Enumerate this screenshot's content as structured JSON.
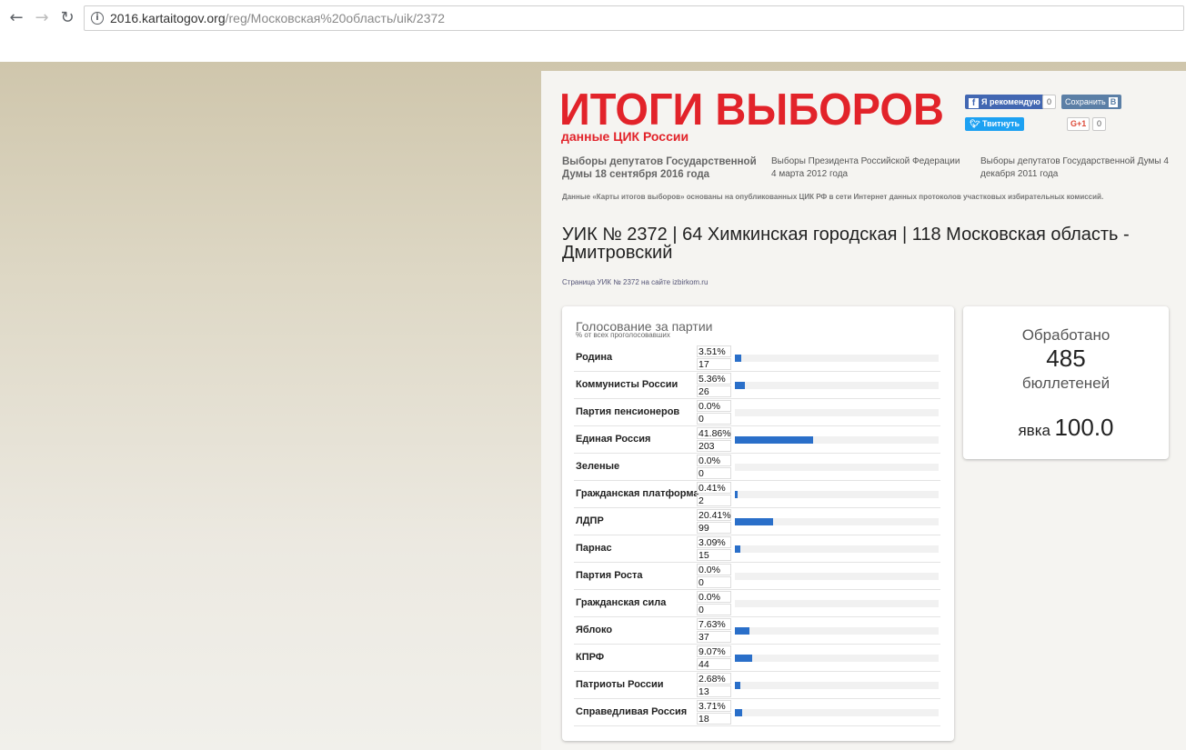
{
  "browser": {
    "url_host": "2016.kartaitogov.org",
    "url_path": "/reg/Московская%20область/uik/2372"
  },
  "header": {
    "logo_title": "ИТОГИ ВЫБОРОВ",
    "logo_subtitle": "данные ЦИК России"
  },
  "social": {
    "fb_label": "Я рекомендую",
    "fb_count": "0",
    "vk_label": "Сохранить",
    "vk_icon": "В",
    "tw_label": "Твитнуть",
    "gp_label": "G+1",
    "gp_count": "0"
  },
  "elections": [
    {
      "label": "Выборы депутатов Государственной Думы 18 сентября 2016 года",
      "active": true
    },
    {
      "label": "Выборы Президента Российской Федерации 4 марта 2012 года",
      "active": false
    },
    {
      "label": "Выборы депутатов Государственной Думы 4 декабря 2011 года",
      "active": false
    }
  ],
  "disclaimer": "Данные «Карты итогов выборов» основаны на опубликованных ЦИК РФ в сети Интернет данных протоколов участковых избирательных комиссий.",
  "uik": {
    "title": "УИК № 2372 | 64 Химкинская городская | 118 Московская область - Дмитровский",
    "link": "Страница УИК № 2372 на сайте izbirkom.ru"
  },
  "votes": {
    "title": "Голосование за партии",
    "subtitle": "% от всех проголосовавших",
    "parties": [
      {
        "name": "Родина",
        "pct_label": "3.51%",
        "pct": 3.51,
        "count": "17"
      },
      {
        "name": "Коммунисты России",
        "pct_label": "5.36%",
        "pct": 5.36,
        "count": "26"
      },
      {
        "name": "Партия пенсионеров",
        "pct_label": "0.0%",
        "pct": 0.0,
        "count": "0"
      },
      {
        "name": "Единая Россия",
        "pct_label": "41.86%",
        "pct": 41.86,
        "count": "203"
      },
      {
        "name": "Зеленые",
        "pct_label": "0.0%",
        "pct": 0.0,
        "count": "0"
      },
      {
        "name": "Гражданская платформа",
        "pct_label": "0.41%",
        "pct": 0.41,
        "count": "2"
      },
      {
        "name": "ЛДПР",
        "pct_label": "20.41%",
        "pct": 20.41,
        "count": "99"
      },
      {
        "name": "Парнас",
        "pct_label": "3.09%",
        "pct": 3.09,
        "count": "15"
      },
      {
        "name": "Партия Роста",
        "pct_label": "0.0%",
        "pct": 0.0,
        "count": "0"
      },
      {
        "name": "Гражданская сила",
        "pct_label": "0.0%",
        "pct": 0.0,
        "count": "0"
      },
      {
        "name": "Яблоко",
        "pct_label": "7.63%",
        "pct": 7.63,
        "count": "37"
      },
      {
        "name": "КПРФ",
        "pct_label": "9.07%",
        "pct": 9.07,
        "count": "44"
      },
      {
        "name": "Патриоты России",
        "pct_label": "2.68%",
        "pct": 2.68,
        "count": "13"
      },
      {
        "name": "Справедливая Россия",
        "pct_label": "3.71%",
        "pct": 3.71,
        "count": "18"
      }
    ]
  },
  "stats": {
    "processed_label": "Обработано",
    "processed_value": "485",
    "ballots_label": "бюллетеней",
    "turnout_label": "явка",
    "turnout_value": "100.0"
  },
  "colors": {
    "brand_red": "#e2232a",
    "bar_blue": "#2a6fc9"
  }
}
